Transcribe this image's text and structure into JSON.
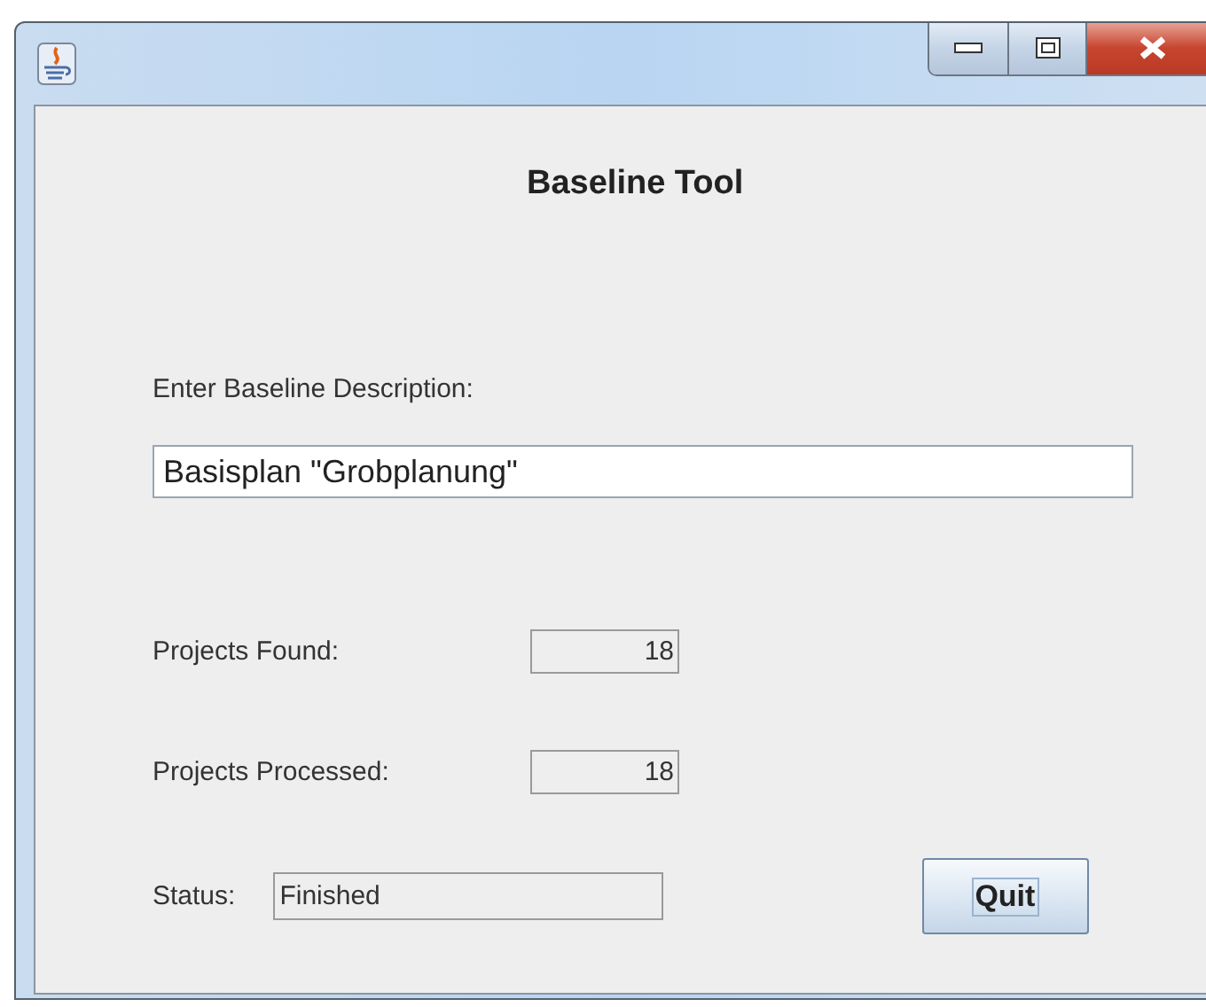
{
  "window": {
    "controls": [
      {
        "kind": "minimize"
      },
      {
        "kind": "maximize"
      },
      {
        "kind": "close"
      }
    ]
  },
  "title": "Baseline Tool",
  "description": {
    "label": "Enter Baseline Description:",
    "value": "Basisplan \"Grobplanung\""
  },
  "counters": [
    {
      "label": "Projects Found:",
      "value": "18"
    },
    {
      "label": "Projects Processed:",
      "value": "18"
    }
  ],
  "status": {
    "label": "Status:",
    "value": "Finished"
  },
  "buttons": [
    {
      "label": "Quit",
      "focused": true
    }
  ]
}
